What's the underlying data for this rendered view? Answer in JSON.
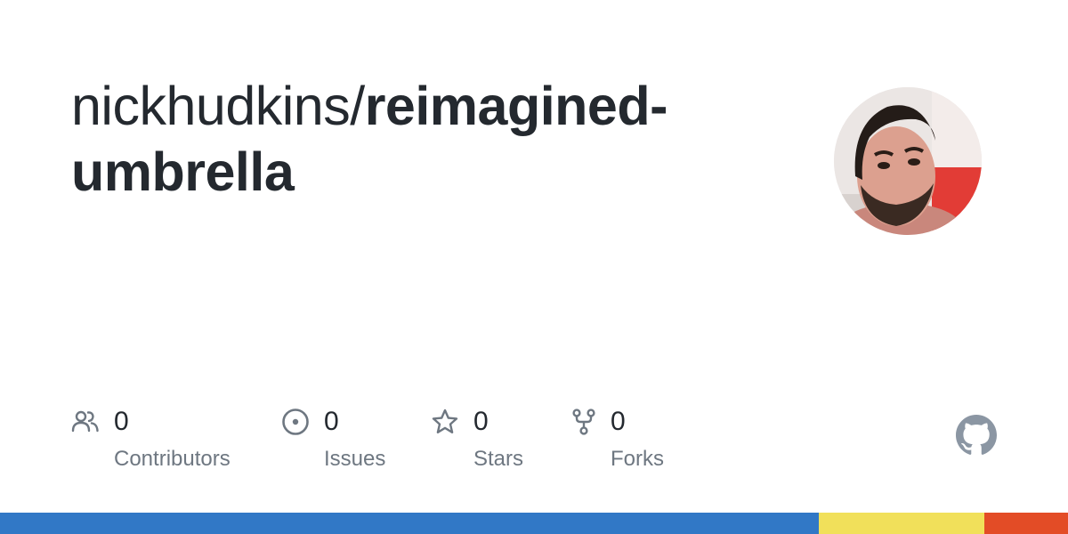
{
  "repo": {
    "owner": "nickhudkins/",
    "name": "reimagined-umbrella"
  },
  "stats": [
    {
      "count": "0",
      "label": "Contributors",
      "icon": "people-icon"
    },
    {
      "count": "0",
      "label": "Issues",
      "icon": "issue-opened-icon"
    },
    {
      "count": "0",
      "label": "Stars",
      "icon": "star-icon"
    },
    {
      "count": "0",
      "label": "Forks",
      "icon": "repo-forked-icon"
    }
  ],
  "avatar": {
    "icon": "owner-avatar"
  },
  "brand": {
    "icon": "github-mark-icon",
    "color": "#8b96a3"
  },
  "language_bar": [
    {
      "color": "#3178c6",
      "fraction": 0.767
    },
    {
      "color": "#f1e05a",
      "fraction": 0.155
    },
    {
      "color": "#e34c26",
      "fraction": 0.078
    }
  ]
}
